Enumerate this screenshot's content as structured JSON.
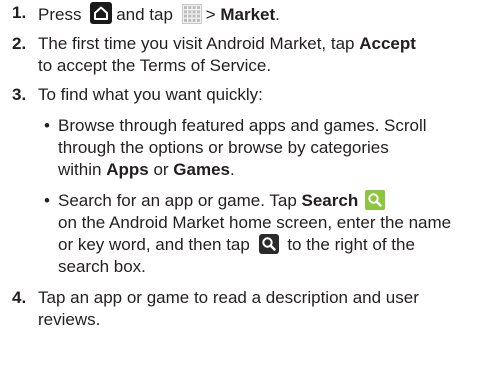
{
  "steps": [
    {
      "number": "1.",
      "parts": {
        "press": "Press",
        "and_tap": "and tap",
        "arrow": ">",
        "market": "Market",
        "period": "."
      }
    },
    {
      "number": "2.",
      "parts": {
        "line_a": "The first time you visit Android Market, tap",
        "accept": "Accept",
        "line_b": "to accept the Terms of Service."
      }
    },
    {
      "number": "3.",
      "parts": {
        "text": "To find what you want quickly:"
      },
      "bullets": [
        {
          "dot": "•",
          "line1": "Browse through featured apps and games. Scroll",
          "line2": "through the options or browse by categories",
          "within": "within",
          "apps": "Apps",
          "or": "or",
          "games": "Games",
          "period": "."
        },
        {
          "dot": "•",
          "search_for": "Search for an app or game. Tap",
          "search": "Search",
          "line2": "on the Android Market home screen, enter the name",
          "line3a": "or key word, and then tap",
          "line3b": "to the right of the",
          "line4": "search box."
        }
      ]
    },
    {
      "number": "4.",
      "parts": {
        "line_a": "Tap an app or game to read a description and user",
        "line_b": "reviews."
      }
    }
  ],
  "icons": {
    "home": "home-icon",
    "apps": "apps-grid-icon",
    "search_green": "search-icon",
    "search_dark": "search-icon"
  },
  "colors": {
    "text": "#231f20",
    "home_icon_bg": "#1a1a1a",
    "search_green": "#8cc63f",
    "search_dark": "#2a2a2a",
    "apps_grid": "#bdbdbd"
  }
}
